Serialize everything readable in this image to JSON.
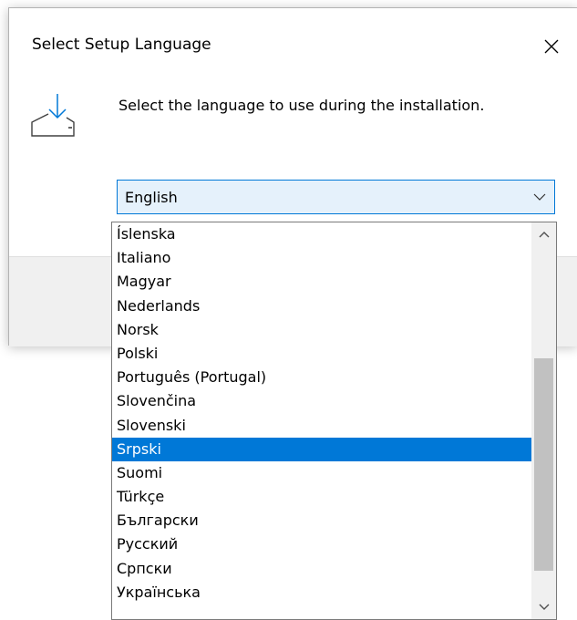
{
  "dialog": {
    "title": "Select Setup Language",
    "instruction": "Select the language to use during the installation."
  },
  "icons": {
    "close": "close-icon",
    "setup": "install-tray-icon",
    "combo_arrow": "chevron-down-icon",
    "scroll_up": "chevron-up-icon",
    "scroll_down": "chevron-down-icon"
  },
  "language_select": {
    "value": "English",
    "options": [
      "Íslenska",
      "Italiano",
      "Magyar",
      "Nederlands",
      "Norsk",
      "Polski",
      "Português (Portugal)",
      "Slovenčina",
      "Slovenski",
      "Srpski",
      "Suomi",
      "Türkçe",
      "Български",
      "Русский",
      "Српски",
      "Українська"
    ],
    "highlighted_index": 9
  },
  "scroll": {
    "thumb_start": 0.32,
    "thumb_end": 0.93
  },
  "colors": {
    "accent": "#0078d7",
    "combo_bg": "#e5f1fb",
    "dialog_bg": "#f0f0f0",
    "thumb": "#c1c1c1"
  }
}
